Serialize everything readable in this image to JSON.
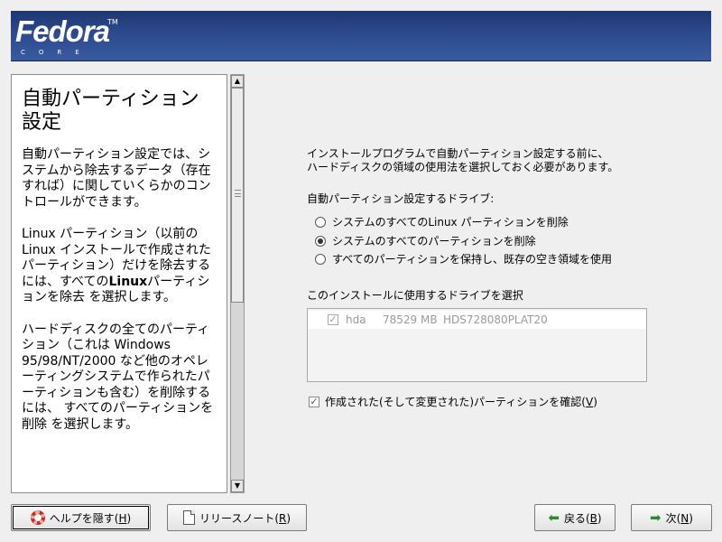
{
  "banner": {
    "logo_main": "Fedora",
    "logo_tm": "TM",
    "logo_sub": "CORE"
  },
  "help": {
    "title": "自動パーティション設定",
    "para1": "自動パーティション設定では、システムから除去するデータ（存在すれば）に関していくらかのコントロールができます。",
    "para2_pre": "Linux パーティション（以前の Linux インストールで作成されたパーティション）だけを除去するには、すべての",
    "para2_bold": "Linux",
    "para2_post": "パーティションを除去 を選択します。",
    "para3": "ハードディスクの全てのパーティション（これは Windows 95/98/NT/2000 など他のオペレーティングシステムで作られたパーティションも含む）を削除するには、 すべてのパーティションを削除 を選択します。"
  },
  "main": {
    "intro_line1": "インストールプログラムで自動パーティション設定する前に、",
    "intro_line2": "ハードディスクの領域の使用法を選択しておく必要があります。",
    "drive_label": "自動パーティション設定するドライブ:",
    "options": [
      {
        "label": "システムのすべてのLinux パーティションを削除",
        "checked": false
      },
      {
        "label": "システムのすべてのパーティションを削除",
        "checked": true
      },
      {
        "label": "すべてのパーティションを保持し、既存の空き領域を使用",
        "checked": false
      }
    ],
    "select_label": "このインストールに使用するドライブを選択",
    "drives": [
      {
        "name": "hda",
        "size": "78529 MB",
        "model": "HDS728080PLAT20",
        "checked": true
      }
    ],
    "confirm_label": "作成された(そして変更された)パーティションを確認(",
    "confirm_key": "V",
    "confirm_close": ")",
    "confirm_checked": true
  },
  "buttons": {
    "help_label": "ヘルプを隠す(",
    "help_key": "H",
    "notes_label": "リリースノート(",
    "notes_key": "R",
    "back_label": "戻る(",
    "back_key": "B",
    "next_label": "次(",
    "next_key": "N",
    "close": ")"
  },
  "icons": {
    "help": "lifebuoy-icon",
    "notes": "document-icon",
    "back": "arrow-left-icon",
    "next": "arrow-right-icon",
    "scroll_up": "arrow-up-icon",
    "scroll_down": "arrow-down-icon",
    "check": "checkmark-icon"
  },
  "colors": {
    "banner": "#2c4a8e",
    "lifebuoy": "#c8281e",
    "arrow": "#2e8a2e"
  }
}
